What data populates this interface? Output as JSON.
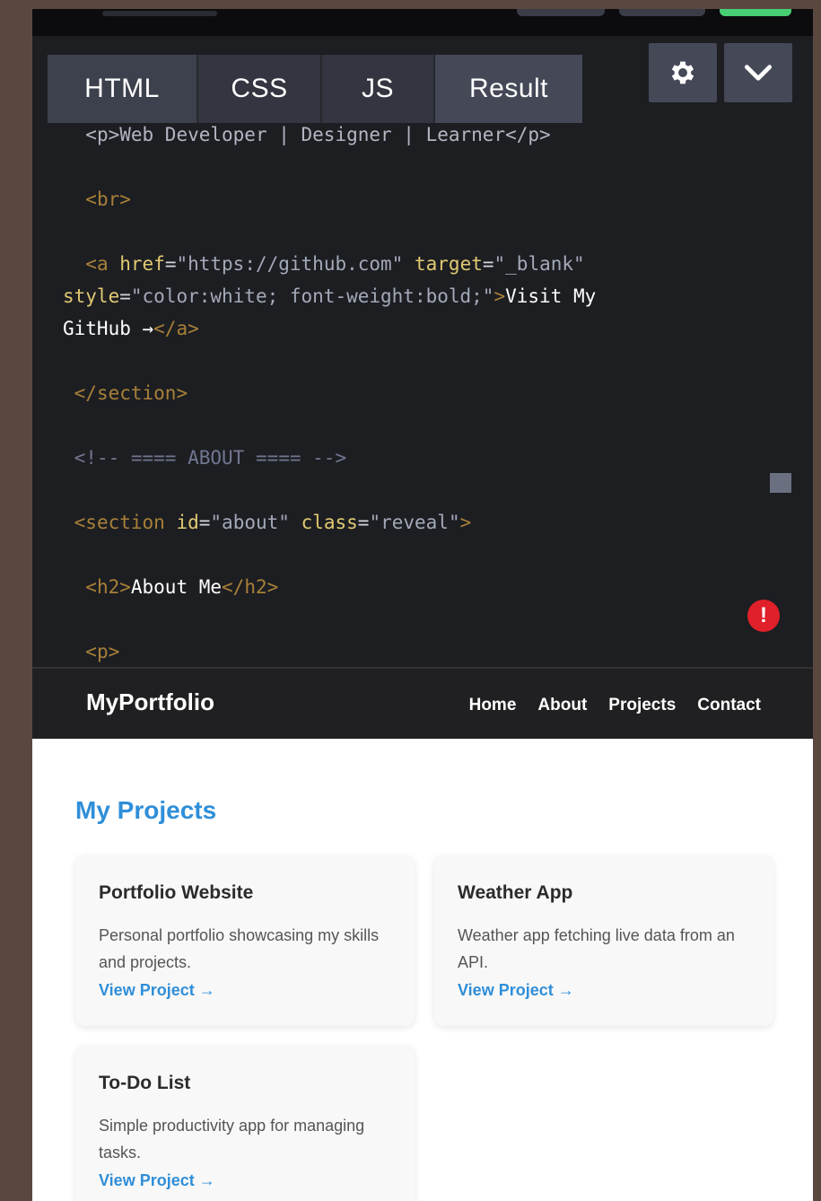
{
  "editor": {
    "tabs": [
      {
        "label": "HTML"
      },
      {
        "label": "CSS"
      },
      {
        "label": "JS"
      },
      {
        "label": "Result"
      }
    ],
    "settings_icon": "gear-icon",
    "collapse_icon": "chevron-down-icon",
    "error_badge": "!",
    "code": {
      "line1": "<p>Web Developer | Designer | Learner</p>",
      "line2_tag": "<br>",
      "line3a_open": "<a ",
      "line3a_attr1": "href",
      "line3a_val1": "\"https://github.com\"",
      "line3a_attr2": "target",
      "line3a_val2": "\"_blank\"",
      "line3b_attr3": "style",
      "line3b_val3": "\"color:white; font-weight:bold;\"",
      "line3b_close": ">",
      "line3b_text": "Visit My",
      "line3c_text": "GitHub →",
      "line3c_end": "</a>",
      "line4": "</section>",
      "line5": "<!-- ==== ABOUT ==== -->",
      "line6_open": "<section ",
      "line6_attr1": "id",
      "line6_val1": "\"about\"",
      "line6_attr2": "class",
      "line6_val2": "\"reveal\"",
      "line6_close": ">",
      "line7_open": "<h2>",
      "line7_text": "About Me",
      "line7_close": "</h2>",
      "line8": "<p>"
    }
  },
  "site": {
    "brand": "MyPortfolio",
    "nav": [
      "Home",
      "About",
      "Projects",
      "Contact"
    ],
    "section_title": "My Projects",
    "projects": [
      {
        "title": "Portfolio Website",
        "desc": "Personal portfolio showcasing my skills and projects.",
        "link": "View Project →"
      },
      {
        "title": "Weather App",
        "desc": "Weather app fetching live data from an API.",
        "link": "View Project →"
      },
      {
        "title": "To-Do List",
        "desc": "Simple productivity app for managing tasks.",
        "link": "View Project →"
      }
    ]
  },
  "colors": {
    "accent_blue": "#2f8ed8",
    "error_red": "#e0202a",
    "run_green": "#47cf73"
  }
}
